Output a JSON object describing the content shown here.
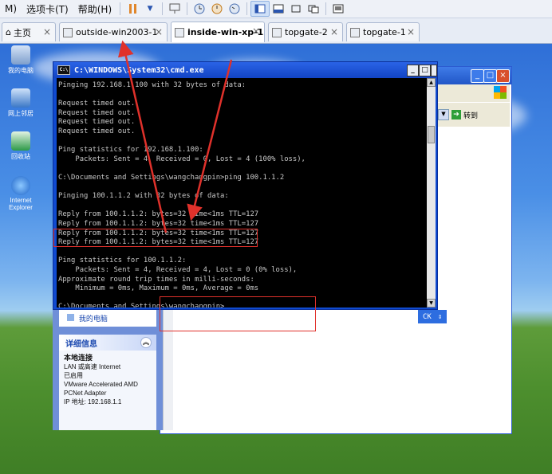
{
  "menubar": {
    "items": [
      "M)",
      "选项卡(T)",
      "帮助(H)"
    ]
  },
  "tabs": [
    {
      "label": "主页"
    },
    {
      "label": "outside-win2003-1"
    },
    {
      "label": "inside-win-xp-1"
    },
    {
      "label": "topgate-2"
    },
    {
      "label": "topgate-1"
    }
  ],
  "desktop_icons": [
    {
      "label": "我的电脑"
    },
    {
      "label": "网上邻居"
    },
    {
      "label": "回收站"
    },
    {
      "label": "Internet Explorer"
    }
  ],
  "cmd": {
    "title": "C:\\WINDOWS\\System32\\cmd.exe",
    "lines": [
      "Pinging 192.168.1.100 with 32 bytes of data:",
      "",
      "Request timed out.",
      "Request timed out.",
      "Request timed out.",
      "Request timed out.",
      "",
      "Ping statistics for 192.168.1.100:",
      "    Packets: Sent = 4, Received = 0, Lost = 4 (100% loss),",
      "",
      "C:\\Documents and Settings\\wangchangpin>ping 100.1.1.2",
      "",
      "Pinging 100.1.1.2 with 32 bytes of data:",
      "",
      "Reply from 100.1.1.2: bytes=32 time<1ms TTL=127",
      "Reply from 100.1.1.2: bytes=32 time<1ms TTL=127",
      "Reply from 100.1.1.2: bytes=32 time<1ms TTL=127",
      "Reply from 100.1.1.2: bytes=32 time<1ms TTL=127",
      "",
      "Ping statistics for 100.1.1.2:",
      "    Packets: Sent = 4, Received = 4, Lost = 0 (0% loss),",
      "Approximate round trip times in milli-seconds:",
      "    Minimum = 0ms, Maximum = 0ms, Average = 0ms",
      "",
      "C:\\Documents and Settings\\wangchangpin>"
    ]
  },
  "explorer": {
    "go_label": "转到",
    "left_top_link": "我的电脑",
    "details_title": "详细信息",
    "details": {
      "name": "本地连接",
      "type": "LAN 或高速 Internet",
      "status": "已启用",
      "adapter": "VMware Accelerated AMD PCNet Adapter",
      "ip": "IP 地址: 192.168.1.1"
    },
    "ok_label": "CK"
  },
  "colors": {
    "annotation": "#e0312b",
    "cmd_text": "#c8c8c8",
    "titlebar": "#1244c4"
  }
}
